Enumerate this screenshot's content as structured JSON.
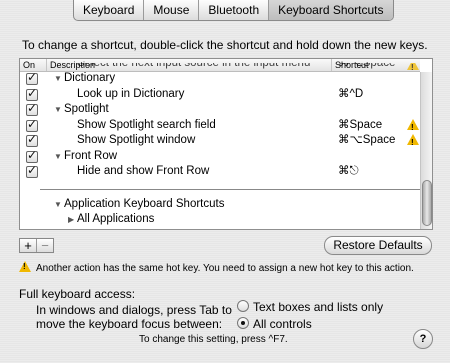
{
  "tabs": [
    {
      "label": "Keyboard",
      "active": false
    },
    {
      "label": "Mouse",
      "active": false
    },
    {
      "label": "Bluetooth",
      "active": false
    },
    {
      "label": "Keyboard Shortcuts",
      "active": true
    }
  ],
  "instruction": "To change a shortcut, double-click the shortcut and hold down the new keys.",
  "table": {
    "headers": {
      "on": "On",
      "description": "Description",
      "shortcut": "Shortcut"
    },
    "rows": [
      {
        "label": "Select the next input source in the input menu",
        "shortcut": "⌘⌥Space",
        "checked": true,
        "level": 2,
        "warning": true,
        "clipped": true
      },
      {
        "label": "Dictionary",
        "shortcut": "",
        "checked": true,
        "level": 1,
        "group": true,
        "warning": false
      },
      {
        "label": "Look up in Dictionary",
        "shortcut": "⌘^D",
        "checked": true,
        "level": 2,
        "warning": false
      },
      {
        "label": "Spotlight",
        "shortcut": "",
        "checked": true,
        "level": 1,
        "group": true,
        "warning": false
      },
      {
        "label": "Show Spotlight search field",
        "shortcut": "⌘Space",
        "checked": true,
        "level": 2,
        "warning": true
      },
      {
        "label": "Show Spotlight window",
        "shortcut": "⌘⌥Space",
        "checked": true,
        "level": 2,
        "warning": true
      },
      {
        "label": "Front Row",
        "shortcut": "",
        "checked": true,
        "level": 1,
        "group": true,
        "warning": false
      },
      {
        "label": "Hide and show Front Row",
        "shortcut": "⌘⎋",
        "checked": true,
        "level": 2,
        "warning": false
      }
    ],
    "app_section": {
      "title": "Application Keyboard Shortcuts",
      "child": "All Applications"
    }
  },
  "buttons": {
    "add": "+",
    "remove": "−",
    "restore_defaults": "Restore Defaults",
    "help": "?"
  },
  "warning_text": "Another action has the same hot key. You need to assign a new hot key to this action.",
  "full_keyboard_access": {
    "title": "Full keyboard access:",
    "desc_line1": "In windows and dialogs, press Tab to",
    "desc_line2": "move the keyboard focus between:",
    "option1": "Text boxes and lists only",
    "option2": "All controls",
    "selected": "All controls",
    "note": "To change this setting, press ^F7."
  },
  "colors": {
    "warning": "#f0b800",
    "window_bg": "#e9e9e9"
  }
}
